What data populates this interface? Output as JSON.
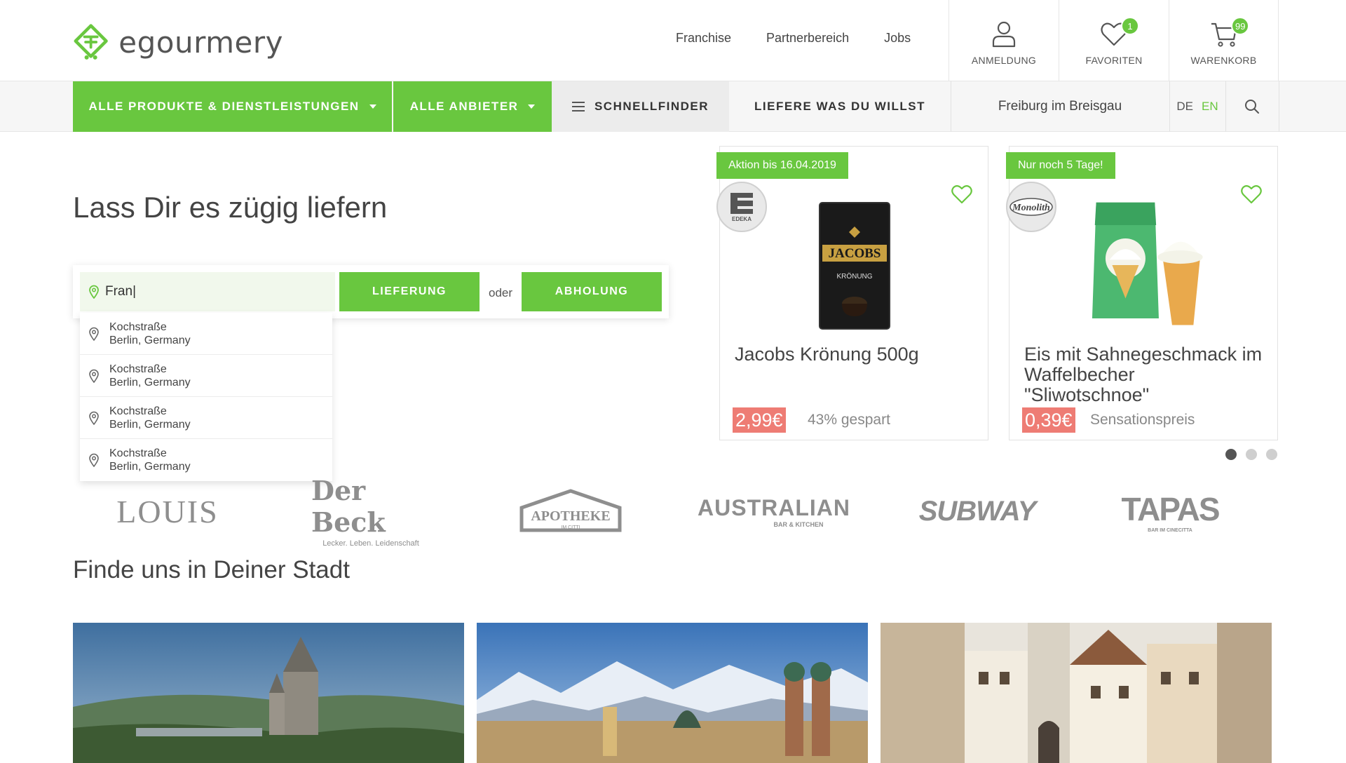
{
  "header": {
    "logo_text": "egourmery",
    "links": [
      "Franchise",
      "Partnerbereich",
      "Jobs"
    ],
    "actions": [
      {
        "label": "ANMELDUNG",
        "icon": "user-icon"
      },
      {
        "label": "FAVORITEN",
        "icon": "heart-icon",
        "badge": "1"
      },
      {
        "label": "WARENKORB",
        "icon": "cart-icon",
        "badge": "99"
      }
    ]
  },
  "nav": {
    "all_products": "ALLE PRODUKTE & DIENSTLEISTUNGEN",
    "all_vendors": "ALLE ANBIETER",
    "quick_finder": "SCHNELLFINDER",
    "deliver_anything": "LIEFERE WAS DU WILLST",
    "city": "Freiburg im Breisgau",
    "lang_de": "DE",
    "lang_en": "EN"
  },
  "hero": {
    "title": "Lass Dir es zügig liefern",
    "address_value": "Fran|",
    "delivery_button": "LIEFERUNG",
    "or_text": "oder",
    "pickup_button": "ABHOLUNG",
    "suggestions": [
      {
        "street": "Kochstraße",
        "city": "Berlin, Germany"
      },
      {
        "street": "Kochstraße",
        "city": "Berlin, Germany"
      },
      {
        "street": "Kochstraße",
        "city": "Berlin, Germany"
      },
      {
        "street": "Kochstraße",
        "city": "Berlin, Germany"
      }
    ]
  },
  "products": [
    {
      "tag": "Aktion bis 16.04.2019",
      "brand": "EDEKA",
      "name": "Jacobs Krönung 500g",
      "price": "2,99€",
      "note": "43% gespart",
      "package_brand": "JACOBS",
      "package_sub": "KRÖNUNG"
    },
    {
      "tag": "Nur noch 5 Tage!",
      "brand": "Monolith",
      "name": "Eis mit Sahnegeschmack im Waffelbecher \"Sliwotschnoe\"",
      "price": "0,39€",
      "note": "Sensationspreis"
    }
  ],
  "carousel": {
    "total": 3,
    "active": 0
  },
  "brands": [
    {
      "name": "LOUIS"
    },
    {
      "name": "Der Beck",
      "tagline": "Lecker. Leben. Leidenschaft"
    },
    {
      "name": "APOTHEKE",
      "tagline": "IM CITTI"
    },
    {
      "name": "AUSTRALIAN",
      "tagline": "BAR & KITCHEN"
    },
    {
      "name": "SUBWAY"
    },
    {
      "name": "TAPAS",
      "tagline": "BAR IM CINECITTA"
    }
  ],
  "cities_section": {
    "title": "Finde uns in Deiner Stadt"
  },
  "colors": {
    "accent": "#69c73f",
    "price": "#ee7c74",
    "text": "#444444"
  }
}
